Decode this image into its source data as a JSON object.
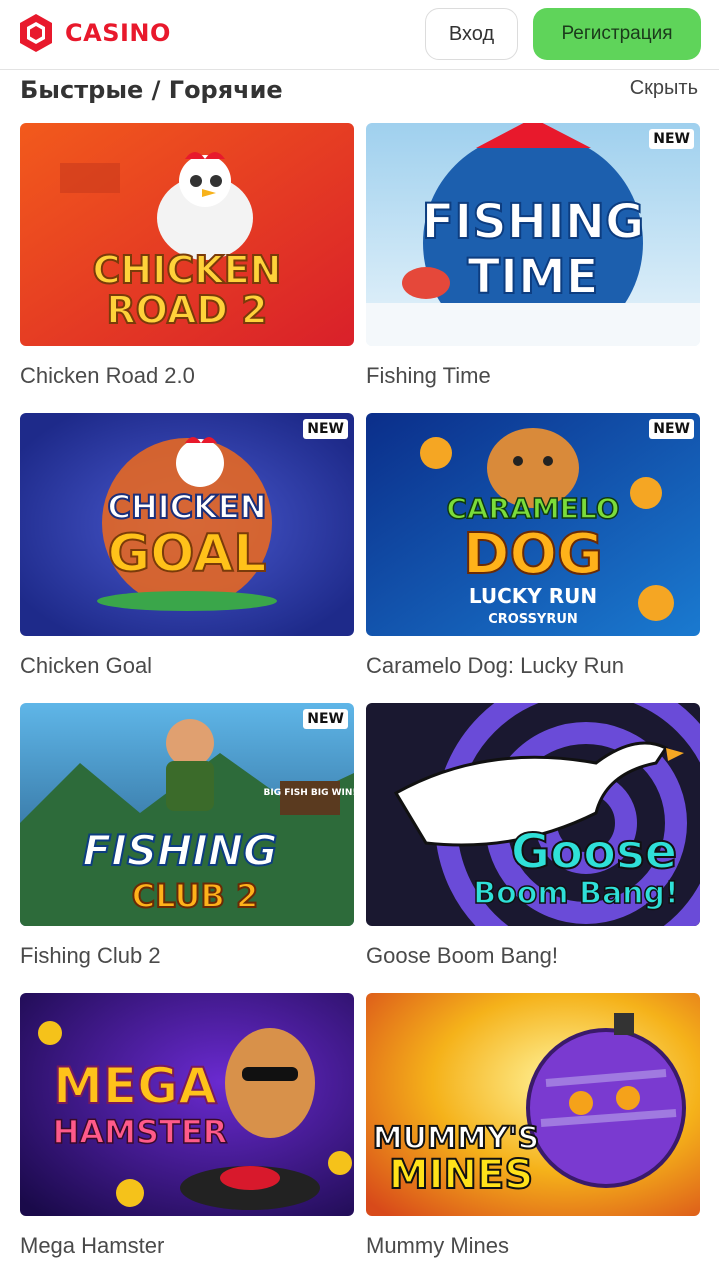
{
  "header": {
    "logo_text": "CASINO",
    "login_label": "Вход",
    "register_label": "Регистрация",
    "accent_color": "#e8192c",
    "register_color": "#5fd45a"
  },
  "section": {
    "title": "Быстрые / Горячие",
    "hide_label": "Скрыть"
  },
  "games": [
    {
      "name": "Chicken Road 2.0",
      "art_text": [
        "CHICKEN",
        "ROAD 2"
      ],
      "is_new": false,
      "badge": ""
    },
    {
      "name": "Fishing Time",
      "art_text": [
        "FISHING",
        "TIME"
      ],
      "is_new": true,
      "badge": "NEW"
    },
    {
      "name": "Chicken Goal",
      "art_text": [
        "CHICKEN",
        "GOAL"
      ],
      "is_new": true,
      "badge": "NEW"
    },
    {
      "name": "Caramelo Dog: Lucky Run",
      "art_text": [
        "CARAMELO",
        "DOG",
        "LUCKY RUN",
        "CROSSYRUN"
      ],
      "is_new": true,
      "badge": "NEW"
    },
    {
      "name": "Fishing Club 2",
      "art_text": [
        "FISHING",
        "CLUB 2",
        "BIG FISH BIG WIN!"
      ],
      "is_new": true,
      "badge": "NEW"
    },
    {
      "name": "Goose Boom Bang!",
      "art_text": [
        "Goose",
        "Boom Bang!"
      ],
      "is_new": false,
      "badge": ""
    },
    {
      "name": "Mega Hamster",
      "art_text": [
        "MEGA",
        "HAMSTER"
      ],
      "is_new": false,
      "badge": ""
    },
    {
      "name": "Mummy Mines",
      "art_text": [
        "MUMMY'S",
        "MINES"
      ],
      "is_new": false,
      "badge": ""
    }
  ]
}
